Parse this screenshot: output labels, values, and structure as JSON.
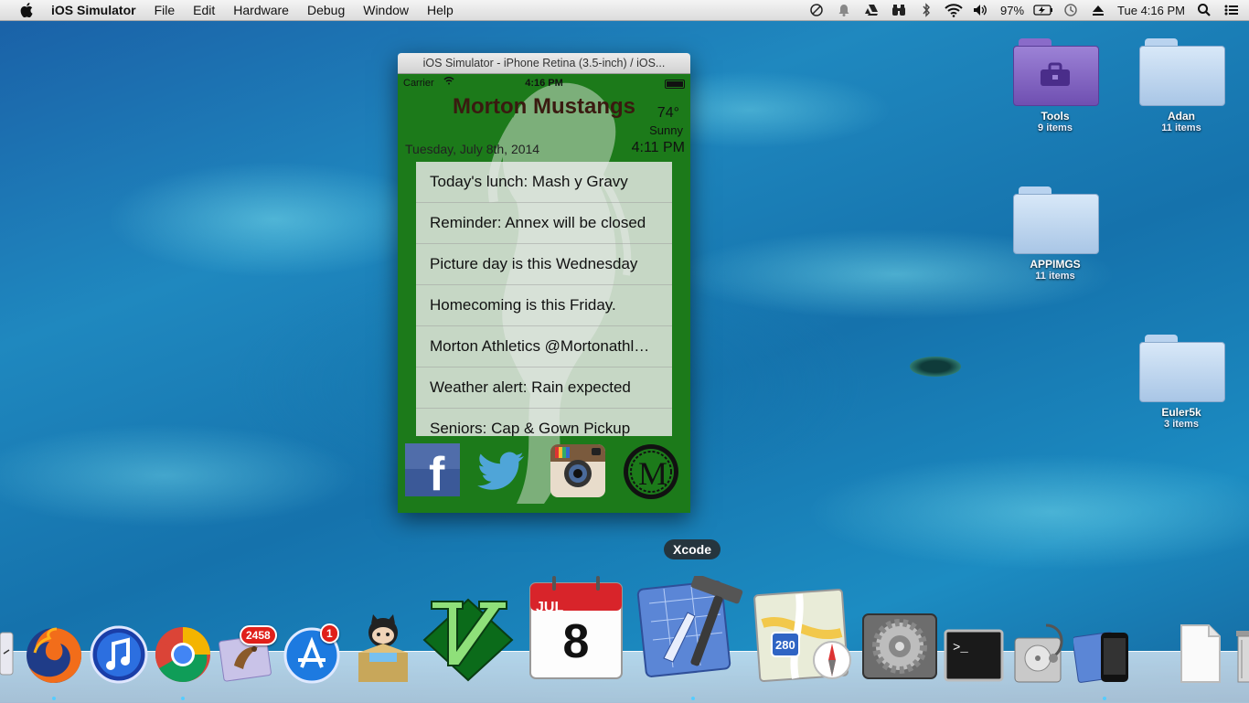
{
  "menubar": {
    "app_name": "iOS Simulator",
    "menus": [
      "File",
      "Edit",
      "Hardware",
      "Debug",
      "Window",
      "Help"
    ],
    "battery": "97%",
    "clock": "Tue 4:16 PM"
  },
  "desktop": {
    "icons": [
      {
        "name": "Tools",
        "count": "9 items"
      },
      {
        "name": "Adan",
        "count": "11 items"
      },
      {
        "name": "APPIMGS",
        "count": "11 items"
      },
      {
        "name": "Euler5k",
        "count": "3 items"
      }
    ]
  },
  "simulator": {
    "window_title": "iOS Simulator - iPhone Retina (3.5-inch) / iOS...",
    "status": {
      "carrier": "Carrier",
      "time": "4:16 PM"
    },
    "app": {
      "school": "Morton Mustangs",
      "temperature": "74°",
      "condition": "Sunny",
      "date": "Tuesday, July 8th, 2014",
      "time": "4:11 PM",
      "news": [
        "Today's lunch: Mash y Gravy",
        "Reminder: Annex will be closed",
        "Picture day is this Wednesday",
        "Homecoming is this Friday.",
        "Morton Athletics @Mortonathletics",
        "Weather alert: Rain expected",
        "Seniors: Cap & Gown Pickup"
      ],
      "social": [
        "facebook-icon",
        "twitter-icon",
        "instagram-icon",
        "morton-logo-icon"
      ],
      "logo_letter": "M",
      "facebook_letter": "f"
    }
  },
  "dock": {
    "tooltip": "Xcode",
    "calendar": {
      "month": "JUL",
      "day": "8"
    },
    "mail_badge": "2458",
    "appstore_badge": "1",
    "maps_shield": "280",
    "items": [
      "Finder",
      "Firefox",
      "iTunes",
      "Chrome",
      "Mail",
      "App Store",
      "GitHub",
      "Vim",
      "Calendar",
      "Xcode",
      "Maps",
      "System Preferences",
      "Terminal",
      "Disk Utility",
      "iOS Simulator",
      "Document",
      "Trash"
    ]
  },
  "colors": {
    "app_green": "#1c7a1a",
    "title_brown": "#3a1a10",
    "badge_red": "#e0201a"
  }
}
